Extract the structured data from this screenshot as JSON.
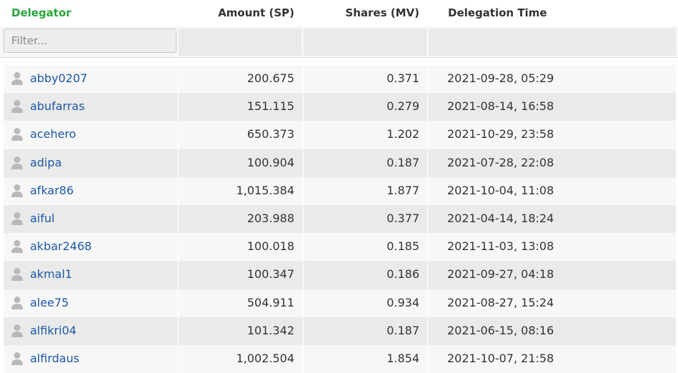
{
  "header": {
    "delegator": "Delegator",
    "amount": "Amount (SP)",
    "shares": "Shares (MV)",
    "time": "Delegation Time"
  },
  "filter": {
    "placeholder": "Filter..."
  },
  "icons": {
    "avatar": "user-avatar-icon"
  },
  "colors": {
    "delegator_header": "#2aa53a",
    "link": "#1b58a6"
  },
  "rows": [
    {
      "user": "abby0207",
      "amount": "200.675",
      "shares": "0.371",
      "time": "2021-09-28, 05:29"
    },
    {
      "user": "abufarras",
      "amount": "151.115",
      "shares": "0.279",
      "time": "2021-08-14, 16:58"
    },
    {
      "user": "acehero",
      "amount": "650.373",
      "shares": "1.202",
      "time": "2021-10-29, 23:58"
    },
    {
      "user": "adipa",
      "amount": "100.904",
      "shares": "0.187",
      "time": "2021-07-28, 22:08"
    },
    {
      "user": "afkar86",
      "amount": "1,015.384",
      "shares": "1.877",
      "time": "2021-10-04, 11:08"
    },
    {
      "user": "aiful",
      "amount": "203.988",
      "shares": "0.377",
      "time": "2021-04-14, 18:24"
    },
    {
      "user": "akbar2468",
      "amount": "100.018",
      "shares": "0.185",
      "time": "2021-11-03, 13:08"
    },
    {
      "user": "akmal1",
      "amount": "100.347",
      "shares": "0.186",
      "time": "2021-09-27, 04:18"
    },
    {
      "user": "alee75",
      "amount": "504.911",
      "shares": "0.934",
      "time": "2021-08-27, 15:24"
    },
    {
      "user": "alfikri04",
      "amount": "101.342",
      "shares": "0.187",
      "time": "2021-06-15, 08:16"
    },
    {
      "user": "alfirdaus",
      "amount": "1,002.504",
      "shares": "1.854",
      "time": "2021-10-07, 21:58"
    }
  ]
}
